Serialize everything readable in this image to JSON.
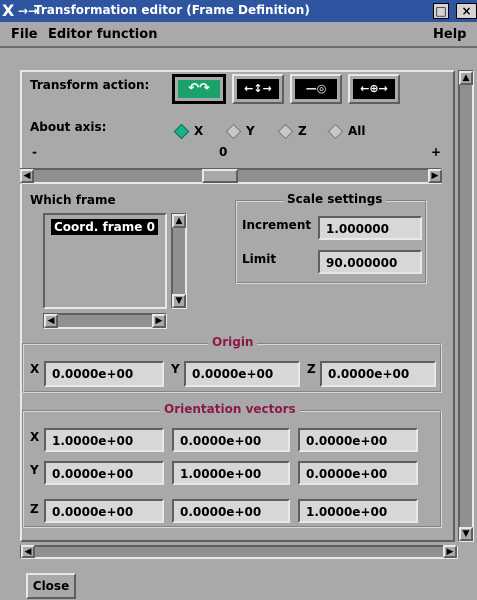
{
  "window": {
    "title": "Transformation editor (Frame Definition)",
    "title_buttons": [
      "□",
      "×"
    ]
  },
  "menubar": {
    "file": "File",
    "editor_function": "Editor function",
    "help": "Help"
  },
  "transform": {
    "label": "Transform action:",
    "actions": [
      {
        "name": "rotate",
        "glyph": "↶↷",
        "selected": true
      },
      {
        "name": "translate",
        "glyph": "←↕→",
        "selected": false
      },
      {
        "name": "scale-one",
        "glyph": "—◎",
        "selected": false
      },
      {
        "name": "scale-all",
        "glyph": "←⊕→",
        "selected": false
      }
    ]
  },
  "axis": {
    "label": "About axis:",
    "options": [
      {
        "label": "X",
        "selected": true
      },
      {
        "label": "Y",
        "selected": false
      },
      {
        "label": "Z",
        "selected": false
      },
      {
        "label": "All",
        "selected": false
      }
    ]
  },
  "slider": {
    "minus": "-",
    "value": "0",
    "plus": "+",
    "position_fraction": 0.47
  },
  "which_frame": {
    "label": "Which frame",
    "items": [
      "Coord. frame 0"
    ]
  },
  "scale": {
    "title": "Scale settings",
    "increment_label": "Increment",
    "increment_value": "1.000000",
    "limit_label": "Limit",
    "limit_value": "90.000000"
  },
  "origin": {
    "title": "Origin",
    "x_label": "X",
    "x_value": "0.0000e+00",
    "y_label": "Y",
    "y_value": "0.0000e+00",
    "z_label": "Z",
    "z_value": "0.0000e+00"
  },
  "orientation": {
    "title": "Orientation vectors",
    "rows": [
      {
        "label": "X",
        "values": [
          "1.0000e+00",
          "0.0000e+00",
          "0.0000e+00"
        ]
      },
      {
        "label": "Y",
        "values": [
          "0.0000e+00",
          "1.0000e+00",
          "0.0000e+00"
        ]
      },
      {
        "label": "Z",
        "values": [
          "0.0000e+00",
          "0.0000e+00",
          "1.0000e+00"
        ]
      }
    ]
  },
  "footer": {
    "close": "Close"
  },
  "colors": {
    "titlebar": "#3055a0",
    "window_bg": "#a9a9a9",
    "field_bg": "#d7d7d7",
    "group_title": "#8b1a4a",
    "selected_green": "#1aa26b",
    "radio_on": "#1fb08a",
    "radio_off": "#c8c8c8"
  }
}
